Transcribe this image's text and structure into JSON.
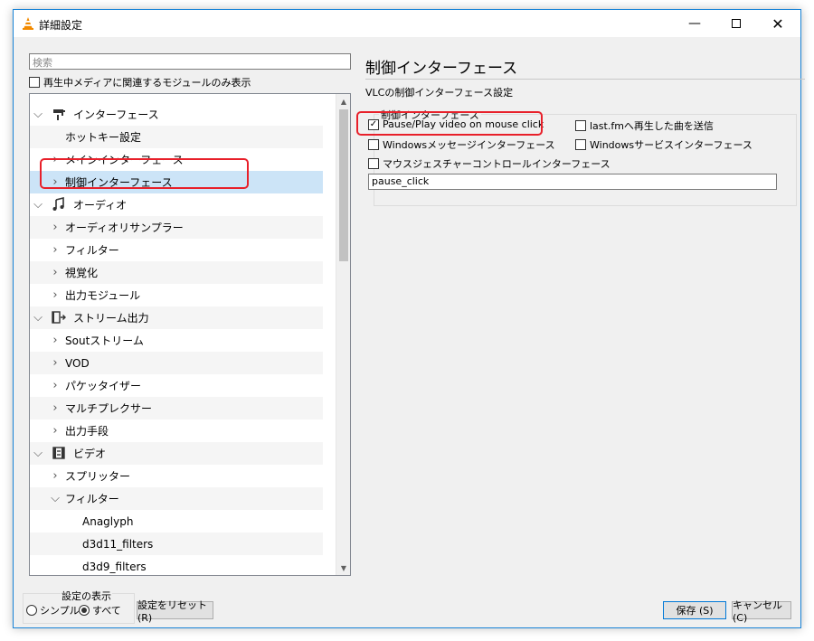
{
  "window": {
    "title": "詳細設定"
  },
  "left": {
    "search_placeholder": "検索",
    "only_current_label": "再生中メディアに関連するモジュールのみ表示",
    "tree": [
      {
        "label": "インターフェース",
        "level": 0,
        "arrow": "expanded",
        "icon": "interface-icon"
      },
      {
        "label": "ホットキー設定",
        "level": 1,
        "arrow": "none"
      },
      {
        "label": "メインインターフェース",
        "level": 1,
        "arrow": "collapsed"
      },
      {
        "label": "制御インターフェース",
        "level": 1,
        "arrow": "collapsed",
        "selected": true
      },
      {
        "label": "オーディオ",
        "level": 0,
        "arrow": "expanded",
        "icon": "audio-icon"
      },
      {
        "label": "オーディオリサンプラー",
        "level": 1,
        "arrow": "collapsed"
      },
      {
        "label": "フィルター",
        "level": 1,
        "arrow": "collapsed"
      },
      {
        "label": "視覚化",
        "level": 1,
        "arrow": "collapsed"
      },
      {
        "label": "出力モジュール",
        "level": 1,
        "arrow": "collapsed"
      },
      {
        "label": "ストリーム出力",
        "level": 0,
        "arrow": "expanded",
        "icon": "stream-output-icon"
      },
      {
        "label": "Soutストリーム",
        "level": 1,
        "arrow": "collapsed"
      },
      {
        "label": "VOD",
        "level": 1,
        "arrow": "collapsed"
      },
      {
        "label": "パケッタイザー",
        "level": 1,
        "arrow": "collapsed"
      },
      {
        "label": "マルチプレクサー",
        "level": 1,
        "arrow": "collapsed"
      },
      {
        "label": "出力手段",
        "level": 1,
        "arrow": "collapsed"
      },
      {
        "label": "ビデオ",
        "level": 0,
        "arrow": "expanded",
        "icon": "video-icon"
      },
      {
        "label": "スプリッター",
        "level": 1,
        "arrow": "collapsed"
      },
      {
        "label": "フィルター",
        "level": 1,
        "arrow": "expanded"
      },
      {
        "label": "Anaglyph",
        "level": 2,
        "arrow": "none"
      },
      {
        "label": "d3d11_filters",
        "level": 2,
        "arrow": "none"
      },
      {
        "label": "d3d9_filters",
        "level": 2,
        "arrow": "none"
      }
    ],
    "display_group": {
      "title": "設定の表示",
      "simple_label": "シンプル",
      "all_label": "すべて",
      "selected": "all"
    },
    "reset_label": "設定をリセット (R)"
  },
  "right": {
    "title": "制御インターフェース",
    "subtitle": "VLCの制御インターフェース設定",
    "group_title": "制御インターフェース",
    "options": [
      {
        "label": "Pause/Play video on mouse click",
        "checked": true
      },
      {
        "label": "last.fmへ再生した曲を送信",
        "checked": false
      },
      {
        "label": "Windowsメッセージインターフェース",
        "checked": false
      },
      {
        "label": "Windowsサービスインターフェース",
        "checked": false
      },
      {
        "label": "マウスジェスチャーコントロールインターフェース",
        "checked": false
      }
    ],
    "modules_value": "pause_click"
  },
  "buttons": {
    "save_label": "保存 (S)",
    "cancel_label": "キャンセル (C)"
  },
  "colors": {
    "accent": "#0078d7",
    "selection": "#cce4f7",
    "highlight": "#e8202a",
    "vlc_orange": "#f28a00"
  }
}
